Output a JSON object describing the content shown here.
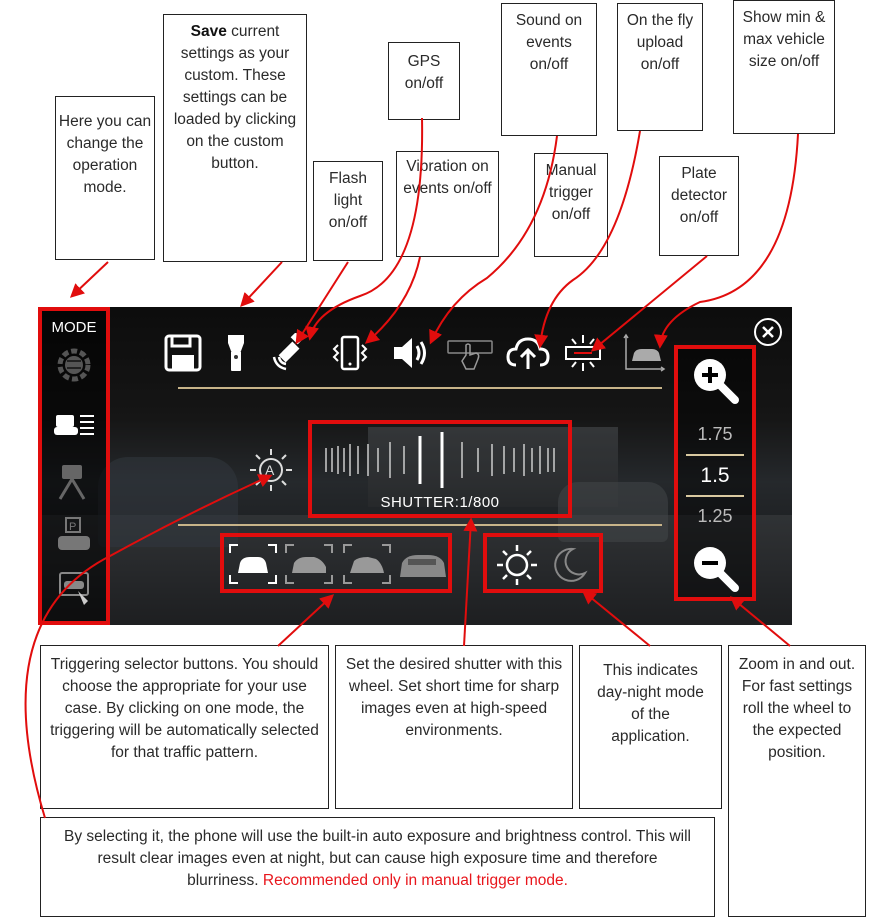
{
  "callouts": {
    "mode": "Here you can change the operation mode.",
    "save_bold": "Save",
    "save_rest": "current settings as your custom. These settings can be loaded by clicking on the custom button.",
    "flash": "Flash light on/off",
    "gps": "GPS on/off",
    "vibration": "Vibration on events on/off",
    "sound": "Sound on events on/off",
    "manual": "Manual trigger on/off",
    "upload": "On the fly upload on/off",
    "plate": "Plate detector on/off",
    "minmax": "Show min & max vehicle size on/off",
    "trigger_selector": "Triggering selector buttons. You should choose the appropriate for your use case. By clicking on one mode, the triggering will be automatically selected for that traffic pattern.",
    "shutter": "Set the desired shutter with this wheel. Set short time for sharp images even at high-speed environments.",
    "daynight": "This indicates day-night mode of the application.",
    "zoom": "Zoom in and out. For fast settings roll the wheel to the expected position.",
    "auto_exposure": "By selecting it, the phone will use the built-in auto exposure and brightness control. This will result clear images even at night, but can cause high exposure time and therefore blurriness.",
    "auto_exposure_red": "Recommended only in manual trigger mode."
  },
  "app": {
    "mode_label": "MODE",
    "shutter_label": "SHUTTER:1/800",
    "zoom_values": [
      "1.75",
      "1.5",
      "1.25"
    ],
    "zoom_selected": "1.5"
  },
  "icons": [
    "mode-settings-icon",
    "custom-mode-icon",
    "tripod-icon",
    "parking-icon",
    "touch-car-icon",
    "save-icon",
    "flashlight-icon",
    "gps-icon",
    "vibration-icon",
    "sound-icon",
    "manual-trigger-icon",
    "upload-icon",
    "plate-detector-icon",
    "vehicle-size-icon",
    "close-icon",
    "zoom-in-icon",
    "zoom-out-icon",
    "auto-exposure-icon",
    "sun-icon",
    "moon-icon"
  ],
  "colors": {
    "accent": "#e10d0d",
    "gold": "#c8b489",
    "red_text": "#e8161c"
  }
}
